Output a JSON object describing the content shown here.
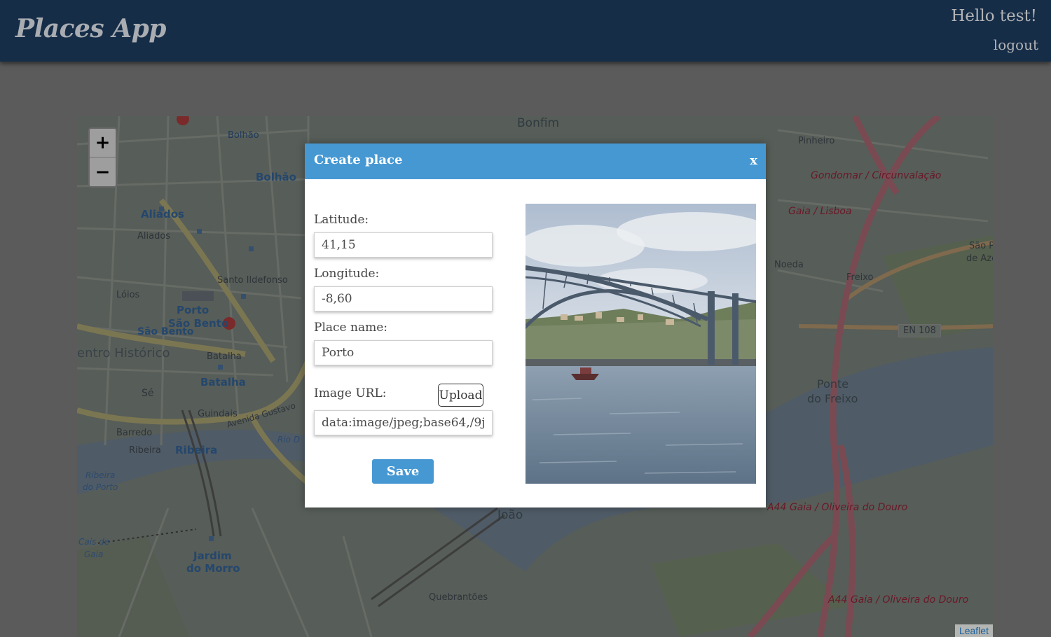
{
  "header": {
    "brand": "Places App",
    "greeting": "Hello test!",
    "logout_label": "logout"
  },
  "map": {
    "zoom_in": "+",
    "zoom_out": "−",
    "attribution": "Leaflet",
    "labels": {
      "bonfim": "Bonfim",
      "bolhao_top": "Bolhão",
      "bolhao": "Bolhão",
      "aliados_station": "Aliados",
      "aliados": "Aliados",
      "santo_ildefonso": "Santo Ildefonso",
      "loios": "Lóios",
      "porto_sao_bento": "Porto",
      "sao_bento": "São Bento",
      "sao_bento2": "São Bento",
      "centro_historico": "entro Histórico",
      "batalha": "Batalha",
      "batalha2": "Batalha",
      "se": "Sé",
      "guindais": "Guindais",
      "barredo": "Barredo",
      "ribeira": "Ribeira",
      "ribeira2": "Ribeira",
      "ribeira_porto": "Ribeira",
      "do_porto": "do Porto",
      "cais_de_gaia": "Cais de",
      "gaia": "Gaia",
      "jardim": "Jardim",
      "do_morro": "do Morro",
      "joao": "João",
      "quebrantoes": "Quebrantões",
      "pinheiro": "Pinheiro",
      "gondomar": "Gondomar / Circunvalação",
      "gaia_lisboa": "Gaia / Lisboa",
      "noeda": "Noeda",
      "freixo": "Freixo",
      "en108": "EN 108",
      "ponte": "Ponte",
      "do_freixo": "do Freixo",
      "a44_1": "A44 Gaia / Oliveira do Douro",
      "a44_2": "A44 Gaia / Oliveira do Douro",
      "sao_pedro": "São P",
      "de_aze": "de Aze",
      "avenida_gustavo": "Avenida Gustavo",
      "rio_douro": "Rio D"
    }
  },
  "modal": {
    "title": "Create place",
    "close_label": "x",
    "latitude_label": "Latitude:",
    "latitude_value": "41,15",
    "longitude_label": "Longitude:",
    "longitude_value": "-8,60",
    "name_label": "Place name:",
    "name_value": "Porto",
    "image_label": "Image URL:",
    "upload_label": "Upload",
    "image_value": "data:image/jpeg;base64,/9j/4AAQSkZJRg",
    "save_label": "Save"
  }
}
